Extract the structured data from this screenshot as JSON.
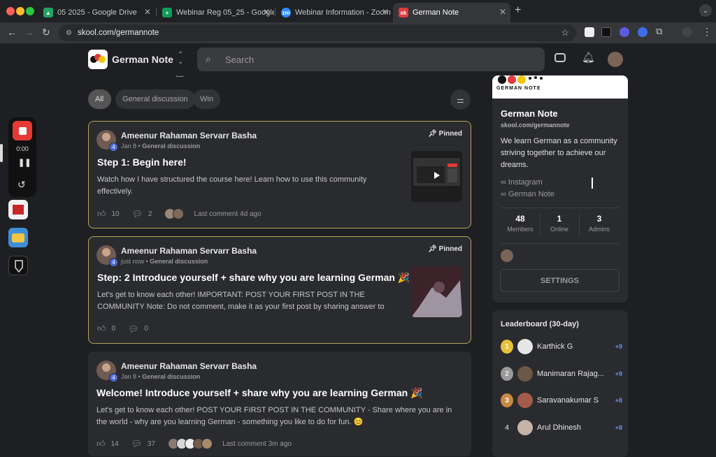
{
  "browser": {
    "tabs": [
      {
        "title": "05 2025 - Google Drive",
        "icon": "google-drive-icon",
        "color": "#1fa463"
      },
      {
        "title": "Webinar Reg 05_25 - Google",
        "icon": "google-sheets-icon",
        "color": "#0f9d58"
      },
      {
        "title": "Webinar Information - Zoom",
        "icon": "zoom-icon",
        "color": "#2d8cff"
      },
      {
        "title": "German Note",
        "icon": "skool-icon",
        "color": "#e23b3b",
        "active": true
      }
    ],
    "url": "skool.com/germannote"
  },
  "recorder": {
    "time": "0:00"
  },
  "header": {
    "community_name": "German Note",
    "search_placeholder": "Search"
  },
  "filters": [
    "All",
    "General discussion",
    "Win"
  ],
  "posts": [
    {
      "author": "Ameenur Rahaman Servarr Basha",
      "level": "4",
      "date": "Jan 8",
      "category": "General discussion",
      "pinned_label": "Pinned",
      "title": "Step 1: Begin here!",
      "body": "Watch how I have structured the course here! Learn how to use this community effectively.",
      "likes": "10",
      "comments": "2",
      "last_comment": "Last comment 4d ago"
    },
    {
      "author": "Ameenur Rahaman Servarr Basha",
      "level": "4",
      "date": "just now",
      "category": "General discussion",
      "pinned_label": "Pinned",
      "title": "Step: 2 Introduce yourself + share why you are learning German 🎉",
      "body": "Let's get to know each other! IMPORTANT: POST YOUR FIRST POST IN THE COMMUNITY Note: Do not comment, make it as your first post by sharing answer to",
      "likes": "0",
      "comments": "0"
    },
    {
      "author": "Ameenur Rahaman Servarr Basha",
      "level": "4",
      "date": "Jan 8",
      "category": "General discussion",
      "title": "Welcome! Introduce yourself + share why you are learning German 🎉",
      "body": "Let's get to know each other! POST YOUR FIRST POST IN THE COMMUNITY - Share where you are in the world - why are you learning German - something you like to do for fun. 😊",
      "likes": "14",
      "comments": "37",
      "last_comment": "Last comment 3m ago"
    }
  ],
  "sidebar": {
    "banner_text": "GERMAN NOTE",
    "name": "German Note",
    "url": "skool.com/germannote",
    "description": "We learn German as a community striving together to achieve our dreams.",
    "links": [
      "Instagram",
      "German Note"
    ],
    "stats": [
      {
        "value": "48",
        "label": "Members"
      },
      {
        "value": "1",
        "label": "Online"
      },
      {
        "value": "3",
        "label": "Admins"
      }
    ],
    "settings_label": "SETTINGS"
  },
  "leaderboard": {
    "title": "Leaderboard (30-day)",
    "rows": [
      {
        "rank": "1",
        "name": "Karthick G",
        "points": "+9"
      },
      {
        "rank": "2",
        "name": "Manimaran Rajag...",
        "points": "+9"
      },
      {
        "rank": "3",
        "name": "Saravanakumar S",
        "points": "+8"
      },
      {
        "rank": "4",
        "name": "Arul Dhinesh",
        "points": "+8"
      }
    ]
  },
  "colors": {
    "pinned_border": "#b9a356",
    "accent_blue": "#6f8ef0",
    "gold": "#e7c13c",
    "silver": "#9a9a9a",
    "bronze": "#c98a43"
  }
}
